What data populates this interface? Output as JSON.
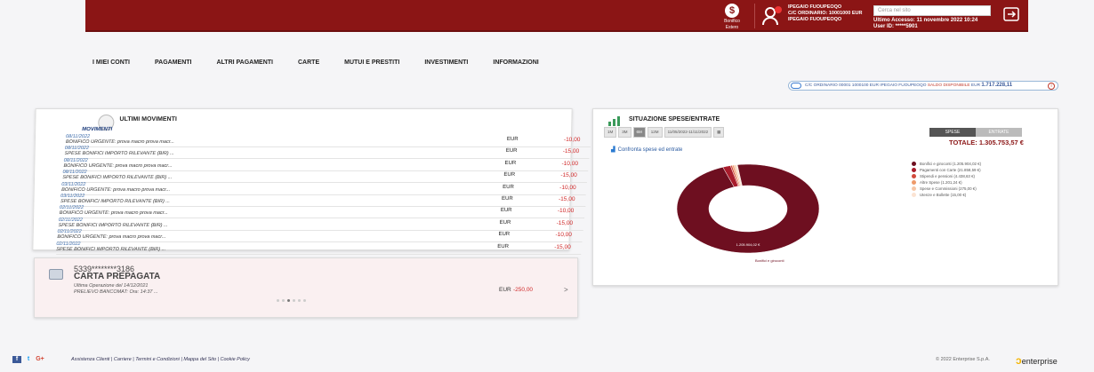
{
  "header": {
    "bonifico_label_1": "Bonifico",
    "bonifico_label_2": "Estero",
    "dollar": "$",
    "user_line_1": "IPEGAIO FUOUPEOQO",
    "user_line_2": "C/C ORDINARIO: 10001000 EUR",
    "user_line_3": "IPEGAIO FUOUPEOQO",
    "search_placeholder": "Cerca nel sito",
    "last_access": "Ultimo Accesso: 11 novembre 2022 10:24",
    "user_id": "User ID: *****5901"
  },
  "nav": [
    "I MIEI CONTI",
    "PAGAMENTI",
    "ALTRI PAGAMENTI",
    "CARTE",
    "MUTUI E PRESTITI",
    "INVESTIMENTI",
    "INFORMAZIONI"
  ],
  "account_bar": {
    "text": "C/C ORDINARIO 00001 1000100 EUR  IPEGAIO FUOUPEOQO",
    "saldo": "SALDO DISPONIBILE",
    "currency": "EUR",
    "amount": "1.717.228,11",
    "info": "i"
  },
  "movements": {
    "title": "ULTIMI MOVIMENTI",
    "subtitle": "MOVIMENTI",
    "rows": [
      {
        "date": "08/11/2022",
        "desc": "BONIFICO URGENTE: prova macro prova macr...",
        "cur": "EUR",
        "amt": "-10,00"
      },
      {
        "date": "08/11/2022",
        "desc": "SPESE BONIFICI IMPORTO RILEVANTE (BIR) ...",
        "cur": "EUR",
        "amt": "-15,00"
      },
      {
        "date": "08/11/2022",
        "desc": "BONIFICO URGENTE: prova macro prova macr...",
        "cur": "EUR",
        "amt": "-10,00"
      },
      {
        "date": "08/11/2022",
        "desc": "SPESE BONIFICI IMPORTO RILEVANTE (BIR) ...",
        "cur": "EUR",
        "amt": "-15,00"
      },
      {
        "date": "03/11/2022",
        "desc": "BONIFICO URGENTE: prova macro prova macr...",
        "cur": "EUR",
        "amt": "-10,00"
      },
      {
        "date": "03/11/2022",
        "desc": "SPESE BONIFICI IMPORTO RILEVANTE (BIR) ...",
        "cur": "EUR",
        "amt": "-15,00"
      },
      {
        "date": "02/11/2022",
        "desc": "BONIFICO URGENTE: prova macro prova macr...",
        "cur": "EUR",
        "amt": "-10,00"
      },
      {
        "date": "02/11/2022",
        "desc": "SPESE BONIFICI IMPORTO RILEVANTE (BIR) ...",
        "cur": "EUR",
        "amt": "-15,00"
      },
      {
        "date": "02/11/2022",
        "desc": "BONIFICO URGENTE: prova macro prova macr...",
        "cur": "EUR",
        "amt": "-10,00"
      },
      {
        "date": "02/11/2022",
        "desc": "SPESE BONIFICI IMPORTO RILEVANTE (BIR) ...",
        "cur": "EUR",
        "amt": "-15,00"
      }
    ]
  },
  "card": {
    "number": "5339********3186",
    "name": "CARTA PREPAGATA",
    "op_line_1": "Ultima Operazione del 14/12/2021",
    "op_line_2": "PRELIEVO BANCOMAT: Ora: 14:37 ...",
    "currency": "EUR",
    "amount": "-250,00",
    "arrow": ">"
  },
  "spese": {
    "title": "SITUAZIONE SPESE/ENTRATE",
    "tabs": [
      "1M",
      "3M",
      "6M",
      "12M",
      "11/05/2022-11/11/2022"
    ],
    "selected_tab": "6M",
    "toggle": [
      "SPESE",
      "ENTRATE"
    ],
    "total": "TOTALE: 1.305.753,57 €",
    "compare_link": "Confronta spese ed entrate",
    "donut_label": "1.205.904,02 €",
    "donut_caption": "Bonifici e giroconti",
    "legend": [
      {
        "label": "Bonifici e giroconti (1.205.904,02 €)",
        "color": "#6e0f20"
      },
      {
        "label": "Pagamenti con Carte (21.858,59 €)",
        "color": "#a81c2c"
      },
      {
        "label": "Stipendi e pensioni (4.438,63 €)",
        "color": "#d24a3c"
      },
      {
        "label": "Altre Spese (1.201,24 €)",
        "color": "#ee9a6a"
      },
      {
        "label": "Spese e Commissioni (275,00 €)",
        "color": "#f6c6a6"
      },
      {
        "label": "Utenze e Bollette (15,00 €)",
        "color": "#fbe3d3"
      }
    ]
  },
  "chart_data": {
    "type": "pie",
    "title": "SITUAZIONE SPESE/ENTRATE",
    "categories": [
      "Bonifici e giroconti",
      "Pagamenti con Carte",
      "Stipendi e pensioni",
      "Altre Spese",
      "Spese e Commissioni",
      "Utenze e Bollette"
    ],
    "values": [
      1205904.02,
      21858.59,
      4438.63,
      1201.24,
      275.0,
      15.0
    ],
    "legend": "right"
  },
  "footer": {
    "links": "Assistenza Clienti  |  Carriere  |  Termini e Condizioni  |  Mappa del Sito  |  Cookie Policy",
    "copyright": "© 2022 Enterprise S.p.A.",
    "logo": "enterprise",
    "social": [
      "f",
      "t",
      "G+"
    ]
  }
}
